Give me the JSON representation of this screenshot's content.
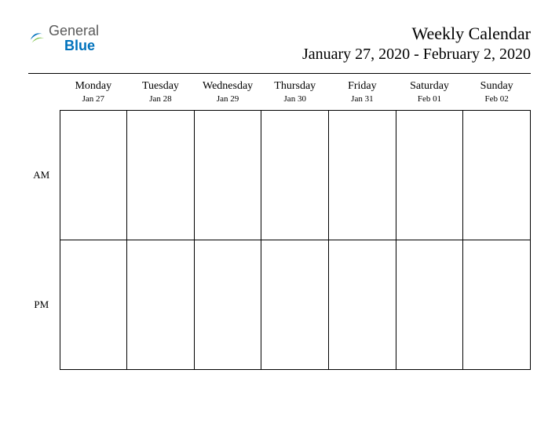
{
  "logo": {
    "general": "General",
    "blue": "Blue"
  },
  "header": {
    "title": "Weekly Calendar",
    "subtitle": "January 27, 2020 - February 2, 2020"
  },
  "rows": [
    {
      "label": "AM"
    },
    {
      "label": "PM"
    }
  ],
  "days": [
    {
      "name": "Monday",
      "date": "Jan 27"
    },
    {
      "name": "Tuesday",
      "date": "Jan 28"
    },
    {
      "name": "Wednesday",
      "date": "Jan 29"
    },
    {
      "name": "Thursday",
      "date": "Jan 30"
    },
    {
      "name": "Friday",
      "date": "Jan 31"
    },
    {
      "name": "Saturday",
      "date": "Feb 01"
    },
    {
      "name": "Sunday",
      "date": "Feb 02"
    }
  ]
}
